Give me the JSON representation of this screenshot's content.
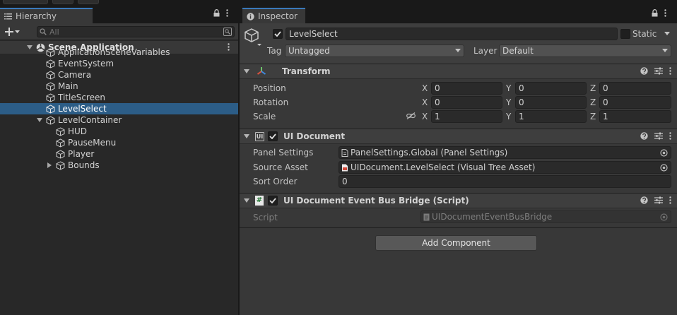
{
  "hierarchy": {
    "tab_label": "Hierarchy",
    "search_placeholder": "All",
    "scene": "Scene.Application",
    "items": [
      {
        "label": "ApplicationSceneVariables"
      },
      {
        "label": "EventSystem"
      },
      {
        "label": "Camera"
      },
      {
        "label": "Main"
      },
      {
        "label": "TitleScreen"
      },
      {
        "label": "LevelSelect"
      },
      {
        "label": "LevelContainer"
      },
      {
        "label": "HUD"
      },
      {
        "label": "PauseMenu"
      },
      {
        "label": "Player"
      },
      {
        "label": "Bounds"
      }
    ]
  },
  "inspector": {
    "tab_label": "Inspector",
    "object_name": "LevelSelect",
    "static_label": "Static",
    "tag_label": "Tag",
    "tag_value": "Untagged",
    "layer_label": "Layer",
    "layer_value": "Default",
    "transform": {
      "title": "Transform",
      "position_label": "Position",
      "rotation_label": "Rotation",
      "scale_label": "Scale",
      "x_label": "X",
      "y_label": "Y",
      "z_label": "Z",
      "position": {
        "x": "0",
        "y": "0",
        "z": "0"
      },
      "rotation": {
        "x": "0",
        "y": "0",
        "z": "0"
      },
      "scale": {
        "x": "1",
        "y": "1",
        "z": "1"
      }
    },
    "ui_document": {
      "title": "UI Document",
      "icon_text": "UI",
      "panel_settings_label": "Panel Settings",
      "panel_settings_value": "PanelSettings.Global (Panel Settings)",
      "source_asset_label": "Source Asset",
      "source_asset_value": "UIDocument.LevelSelect (Visual Tree Asset)",
      "sort_order_label": "Sort Order",
      "sort_order_value": "0"
    },
    "bus_bridge": {
      "title": "UI Document Event Bus Bridge (Script)",
      "icon_text": "#",
      "script_label": "Script",
      "script_value": "UIDocumentEventBusBridge"
    },
    "add_component_label": "Add Component"
  },
  "colors": {
    "selection": "#2c5d87",
    "tab_accent": "#3a79bb",
    "panel_bg": "#383838"
  }
}
